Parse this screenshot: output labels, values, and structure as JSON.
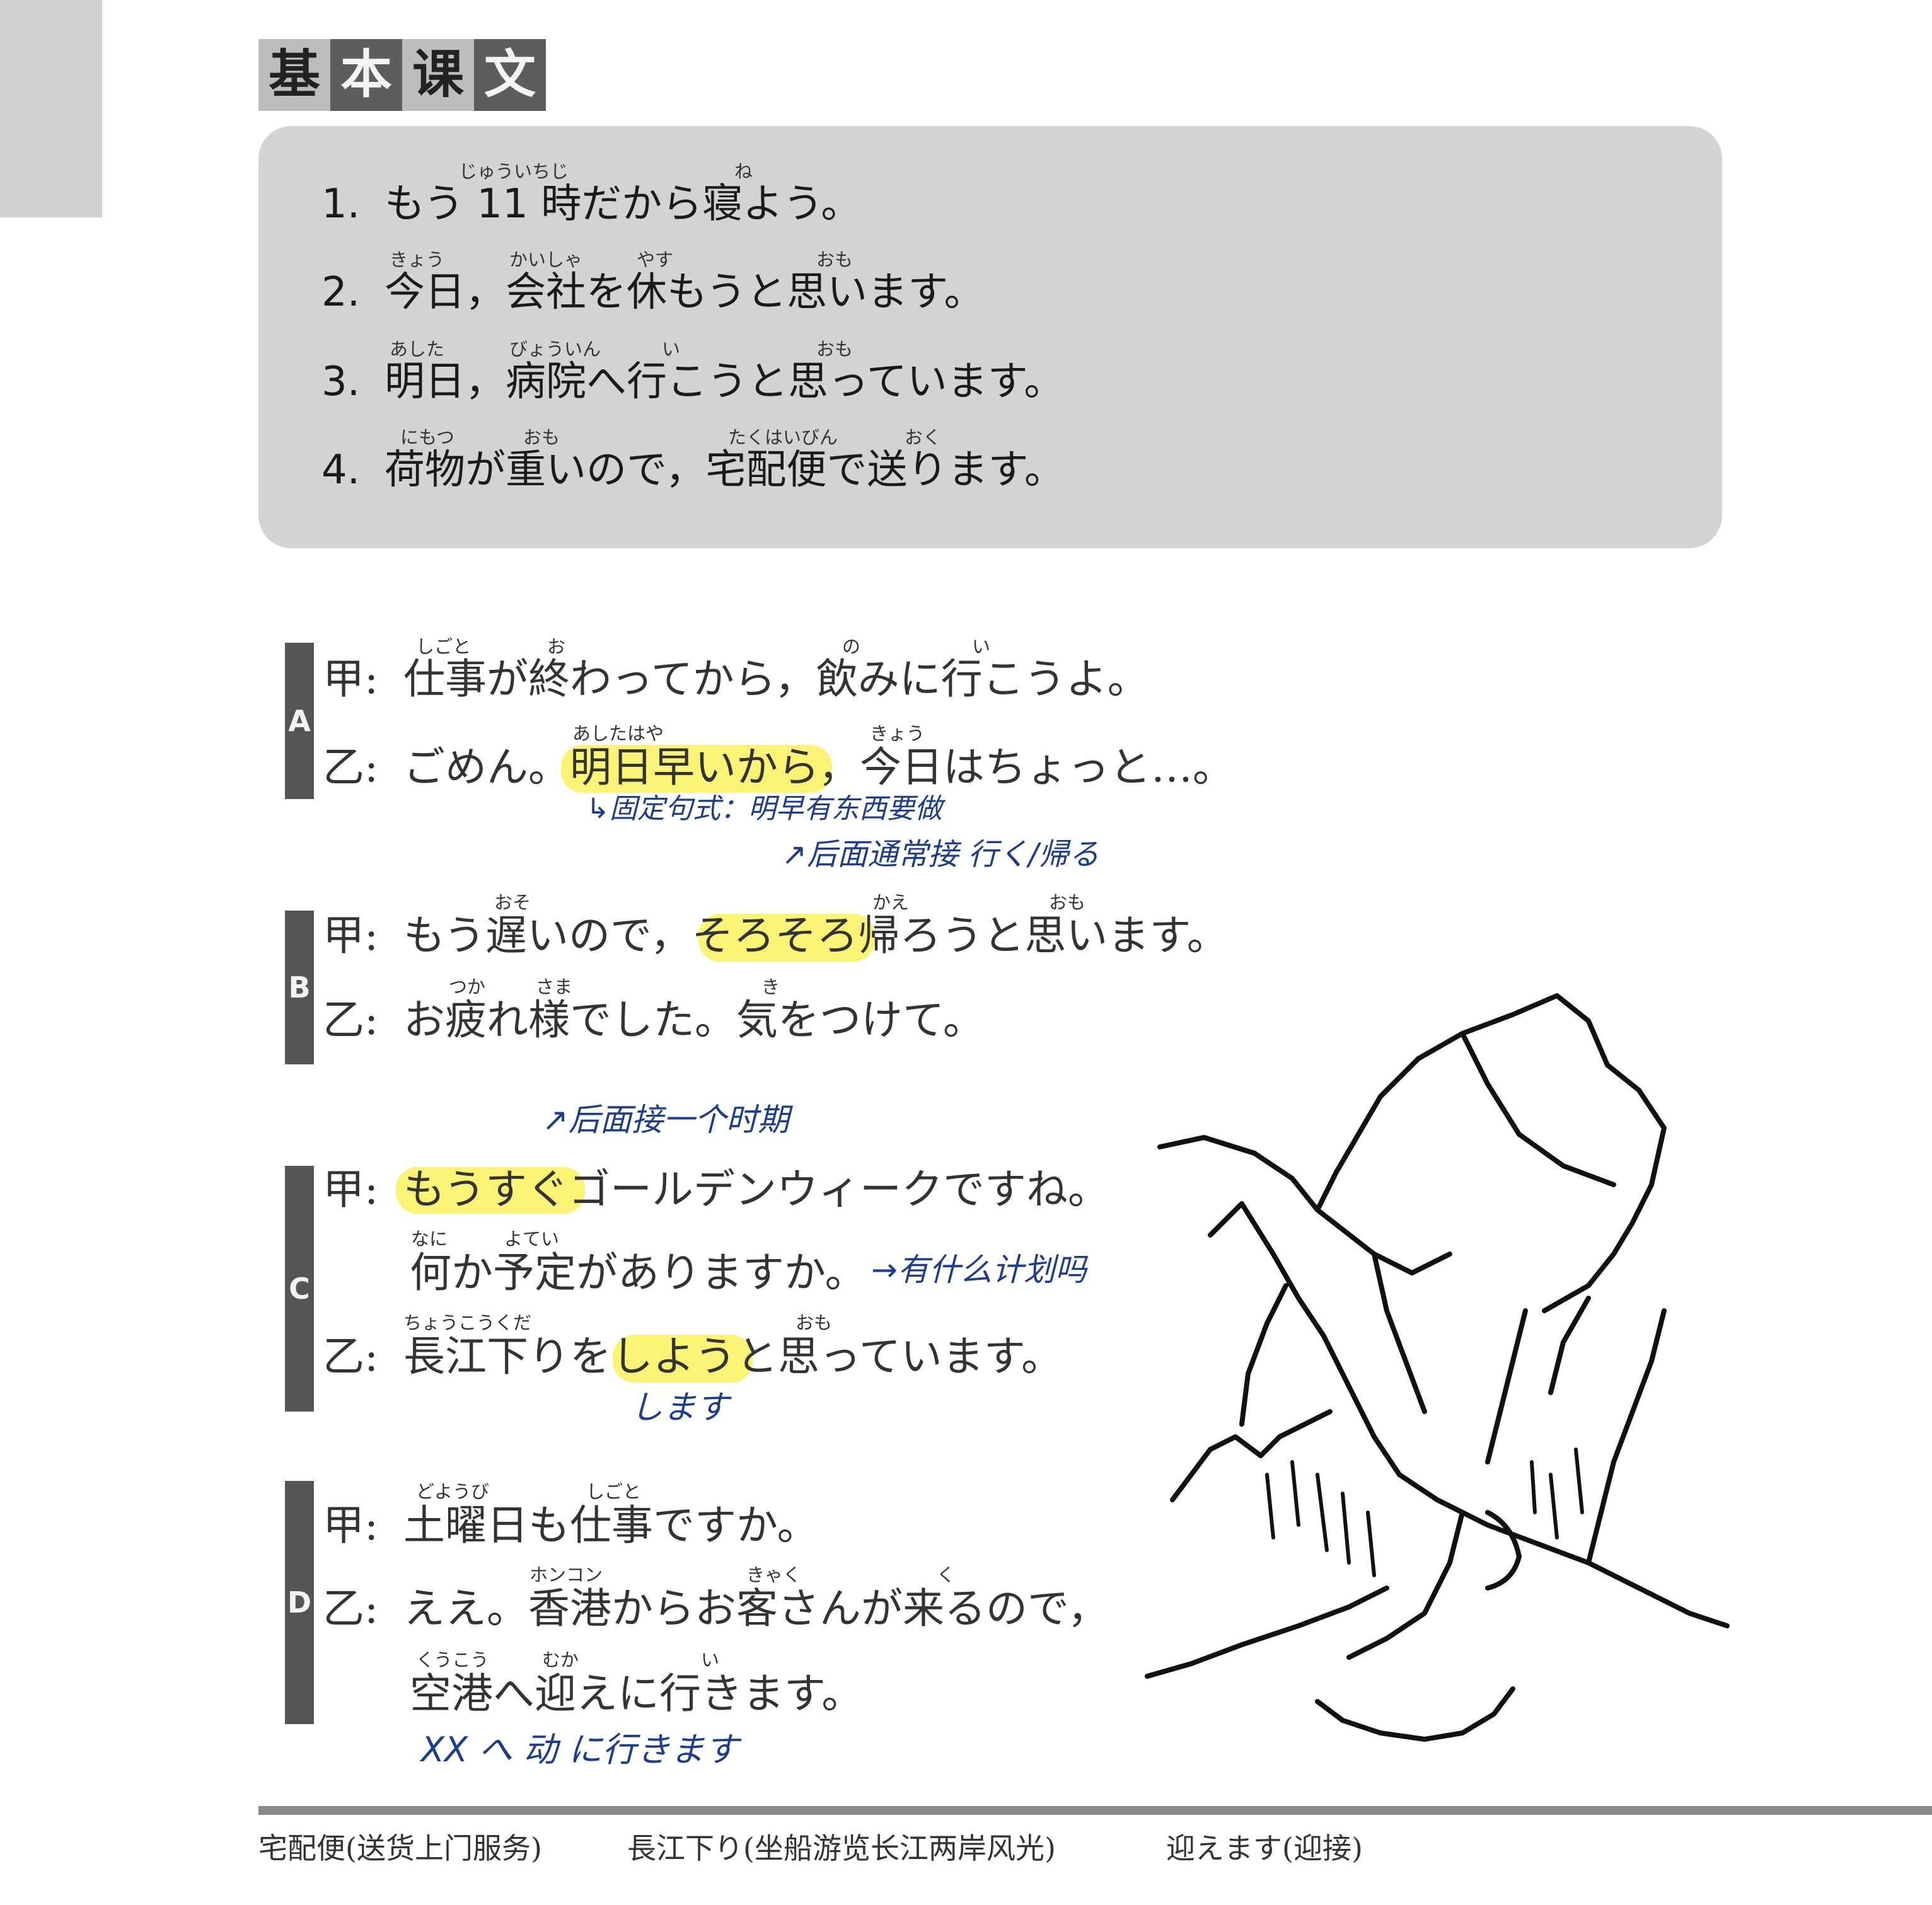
{
  "title": [
    "基",
    "本",
    "课",
    "文"
  ],
  "sentences": [
    {
      "num": "1.",
      "text": "もう 11 時だから寝よう。",
      "ruby": [
        "じゅういちじ",
        "ね"
      ]
    },
    {
      "num": "2.",
      "text": "今日，会社を休もうと思います。",
      "ruby": [
        "きょう",
        "かいしゃ",
        "やす",
        "おも"
      ]
    },
    {
      "num": "3.",
      "text": "明日，病院へ行こうと思っています。",
      "ruby": [
        "あした",
        "びょういん",
        "い",
        "おも"
      ]
    },
    {
      "num": "4.",
      "text": "荷物が重いので，宅配便で送ります。",
      "ruby": [
        "にもつ",
        "おも",
        "たくはいびん",
        "おく"
      ]
    }
  ],
  "dialogs": {
    "A": {
      "label": "A",
      "lines": [
        {
          "speaker": "甲:",
          "text": "仕事が終わってから，飲みに行こうよ。",
          "ruby": [
            "しごと",
            "お",
            "の",
            "い"
          ]
        },
        {
          "speaker": "乙:",
          "text": "ごめん。明日早いから，今日はちょっと…。",
          "ruby": [
            "あしたはや",
            "きょう"
          ]
        }
      ]
    },
    "B": {
      "label": "B",
      "lines": [
        {
          "speaker": "甲:",
          "text": "もう遅いので，そろそろ帰ろうと思います。",
          "ruby": [
            "おそ",
            "かえ",
            "おも"
          ]
        },
        {
          "speaker": "乙:",
          "text": "お疲れ様でした。気をつけて。",
          "ruby": [
            "つか",
            "さま",
            "き"
          ]
        }
      ]
    },
    "C": {
      "label": "C",
      "lines": [
        {
          "speaker": "甲:",
          "text": "もうすぐゴールデンウィークですね。",
          "ruby": []
        },
        {
          "speaker": "",
          "text": "何か予定がありますか。",
          "ruby": [
            "なに",
            "よてい"
          ]
        },
        {
          "speaker": "乙:",
          "text": "長江下りをしようと思っています。",
          "ruby": [
            "ちょうこうくだ",
            "おも"
          ]
        }
      ]
    },
    "D": {
      "label": "D",
      "lines": [
        {
          "speaker": "甲:",
          "text": "土曜日も仕事ですか。",
          "ruby": [
            "どようび",
            "しごと"
          ]
        },
        {
          "speaker": "乙:",
          "text": "ええ。香港からお客さんが来るので，",
          "ruby": [
            "ホンコン",
            "きゃく",
            "く"
          ]
        },
        {
          "speaker": "",
          "text": "空港へ迎えに行きます。",
          "ruby": [
            "くうこう",
            "むか",
            "い"
          ]
        }
      ]
    }
  },
  "notes": {
    "a": "↳固定句式：明早有东西要做",
    "b": "↗后面通常接 行く/帰る",
    "c1": "↗后面接一个时期",
    "c2": "→有什么计划吗",
    "c3": "します",
    "d": "XX へ 动 に行きます"
  },
  "footer": [
    "宅配便(送货上门服务)",
    "長江下り(坐船游览长江两岸风光)",
    "迎えます(迎接)"
  ],
  "colors": {
    "highlight": "#fbf266",
    "ink": "#1c3d8e",
    "box": "#d3d3d5",
    "bar": "#555558"
  }
}
